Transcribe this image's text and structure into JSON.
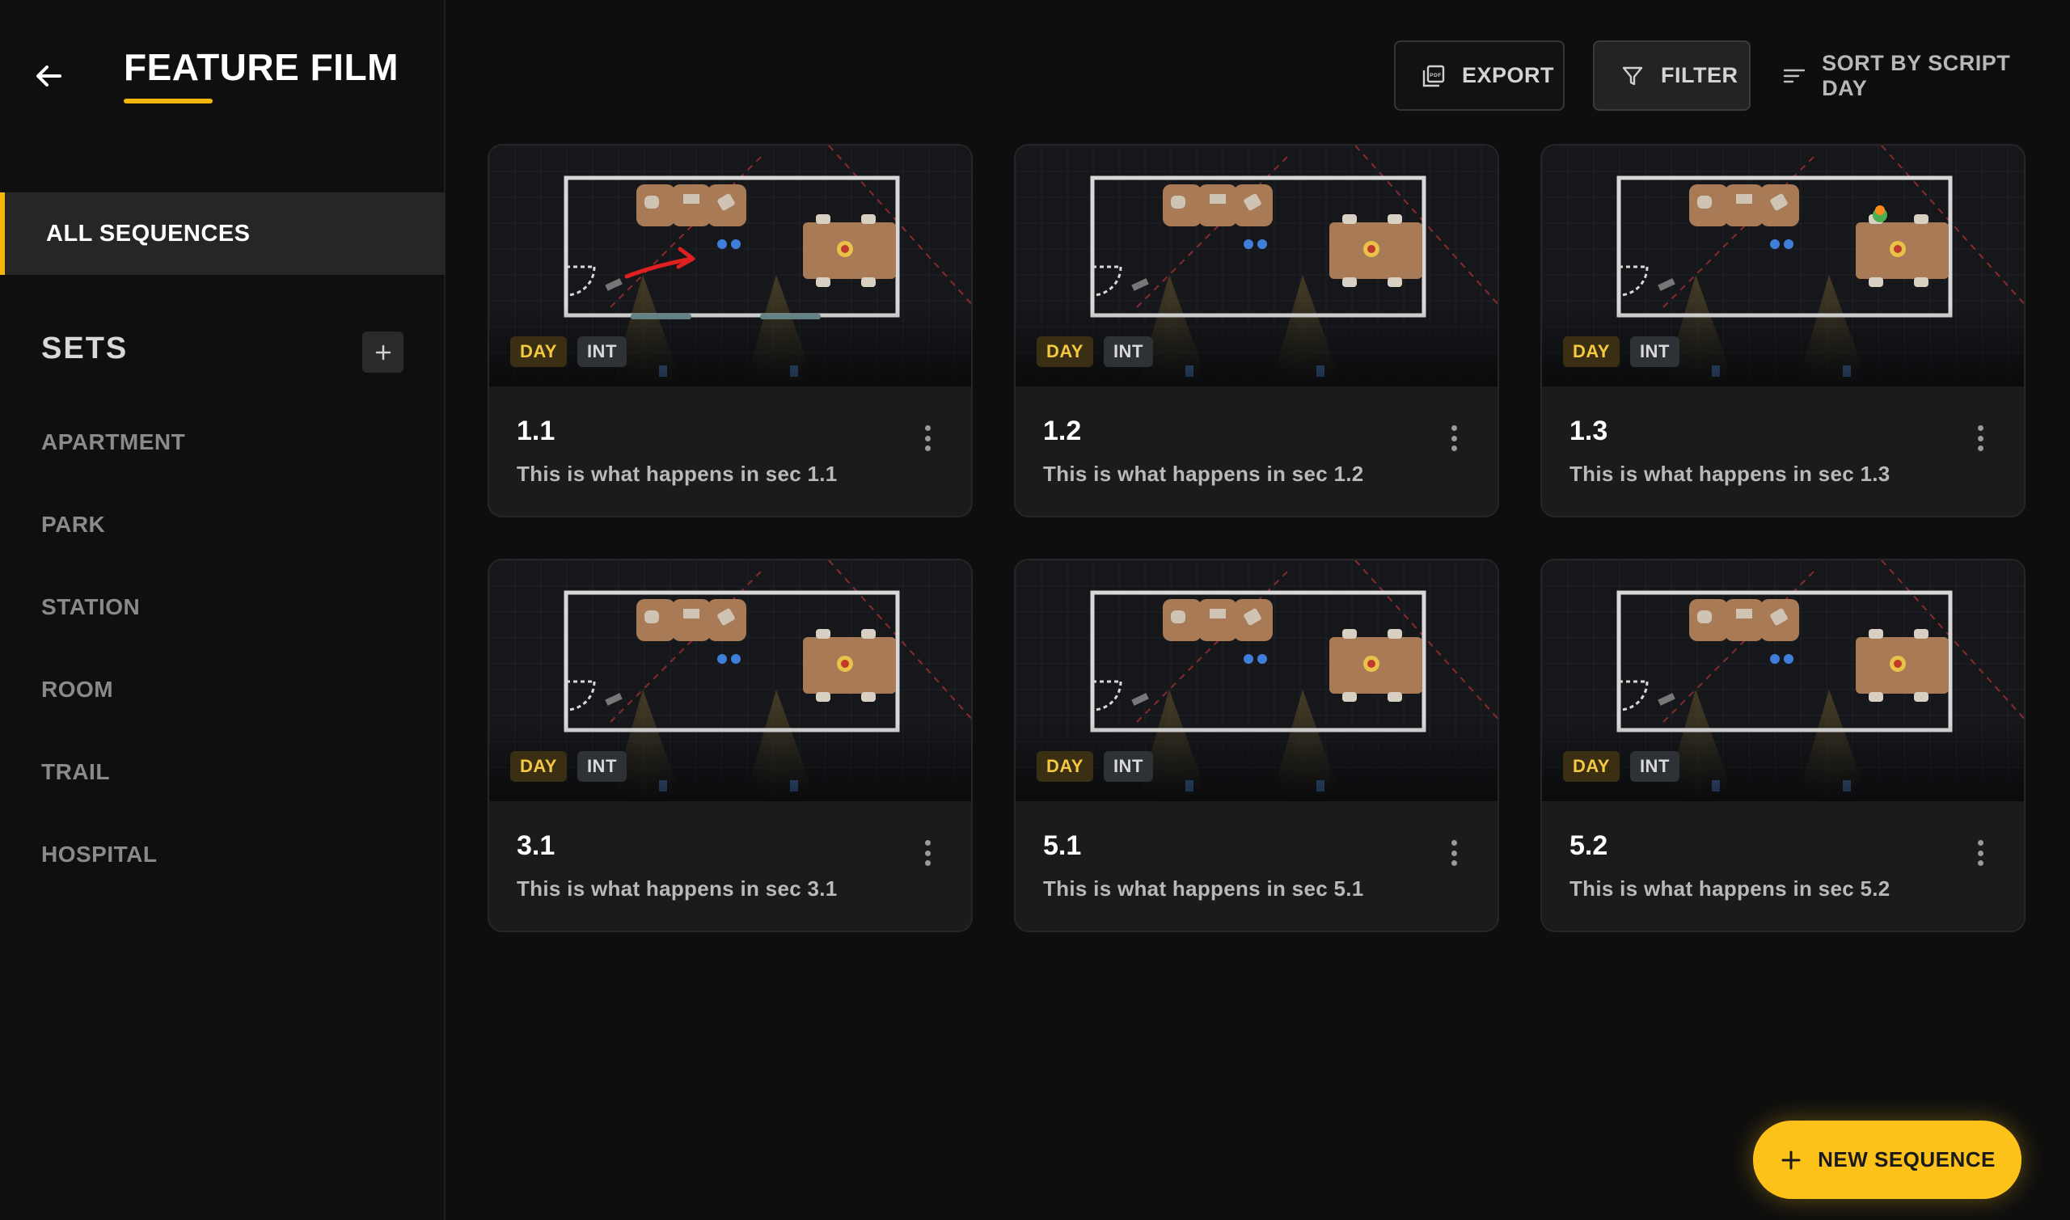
{
  "sidebar": {
    "project_title": "FEATURE FILM",
    "all_sequences_label": "ALL SEQUENCES",
    "sets_header": "SETS",
    "sets": [
      "APARTMENT",
      "PARK",
      "STATION",
      "ROOM",
      "TRAIL",
      "HOSPITAL"
    ]
  },
  "toolbar": {
    "export_label": "EXPORT",
    "filter_label": "FILTER",
    "sort_label": "SORT BY SCRIPT DAY"
  },
  "cards": [
    {
      "number": "1.1",
      "description": "This is what happens in sec 1.1",
      "tags": [
        "DAY",
        "INT"
      ]
    },
    {
      "number": "1.2",
      "description": "This is what happens in sec 1.2",
      "tags": [
        "DAY",
        "INT"
      ]
    },
    {
      "number": "1.3",
      "description": "This is what happens in sec 1.3",
      "tags": [
        "DAY",
        "INT"
      ]
    },
    {
      "number": "3.1",
      "description": "This is what happens in sec 3.1",
      "tags": [
        "DAY",
        "INT"
      ]
    },
    {
      "number": "5.1",
      "description": "This is what happens in sec 5.1",
      "tags": [
        "DAY",
        "INT"
      ]
    },
    {
      "number": "5.2",
      "description": "This is what happens in sec 5.2",
      "tags": [
        "DAY",
        "INT"
      ]
    }
  ],
  "fab": {
    "label": "NEW SEQUENCE"
  },
  "colors": {
    "accent": "#fdc21a",
    "background": "#0e0e0e",
    "card": "#1b1b1d"
  }
}
